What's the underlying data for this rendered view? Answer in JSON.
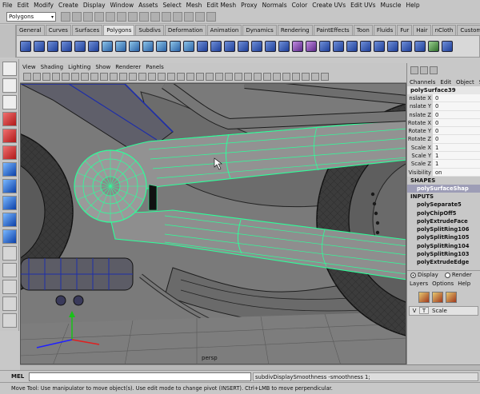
{
  "menu": [
    "File",
    "Edit",
    "Modify",
    "Create",
    "Display",
    "Window",
    "Assets",
    "Select",
    "Mesh",
    "Edit Mesh",
    "Proxy",
    "Normals",
    "Color",
    "Create UVs",
    "Edit UVs",
    "Muscle",
    "Help"
  ],
  "mode_selector": "Polygons",
  "shelf_tabs": [
    "General",
    "Curves",
    "Surfaces",
    "Polygons",
    "Subdivs",
    "Deformation",
    "Animation",
    "Dynamics",
    "Rendering",
    "PaintEffects",
    "Toon",
    "Fluids",
    "Fur",
    "Hair",
    "nCloth",
    "Custom"
  ],
  "active_shelf": "Polygons",
  "panel_menu": [
    "View",
    "Shading",
    "Lighting",
    "Show",
    "Renderer",
    "Panels"
  ],
  "camera_label": "persp",
  "channel_box": {
    "menu": [
      "Channels",
      "Edit",
      "Object",
      "Sh"
    ],
    "object_name": "polySurface39",
    "attributes": [
      {
        "name": "nslate X",
        "value": "0"
      },
      {
        "name": "nslate Y",
        "value": "0"
      },
      {
        "name": "nslate Z",
        "value": "0"
      },
      {
        "name": "Rotate X",
        "value": "0"
      },
      {
        "name": "Rotate Y",
        "value": "0"
      },
      {
        "name": "Rotate Z",
        "value": "0"
      },
      {
        "name": "Scale X",
        "value": "1"
      },
      {
        "name": "Scale Y",
        "value": "1"
      },
      {
        "name": "Scale Z",
        "value": "1"
      },
      {
        "name": "Visibility",
        "value": "on"
      }
    ],
    "shapes_header": "SHAPES",
    "shape": "polySurfaceShap",
    "inputs_header": "INPUTS",
    "inputs": [
      "polySeparate5",
      "polyChipOff5",
      "polyExtrudeFace",
      "polySplitRing106",
      "polySplitRing105",
      "polySplitRing104",
      "polySplitRing103",
      "polyExtrudeEdge"
    ]
  },
  "layer_editor": {
    "display_label": "Display",
    "render_label": "Render",
    "menu": [
      "Layers",
      "Options",
      "Help"
    ],
    "row": {
      "visible": "V",
      "type": "T",
      "name": "Scale"
    }
  },
  "command_line": {
    "label": "MEL",
    "result": "subdivDisplaySmoothness -smoothness 1;"
  },
  "help_line": "Move Tool: Use manipulator to move object(s). Use edit mode to change pivot (INSERT). Ctrl+LMB to move perpendicular."
}
